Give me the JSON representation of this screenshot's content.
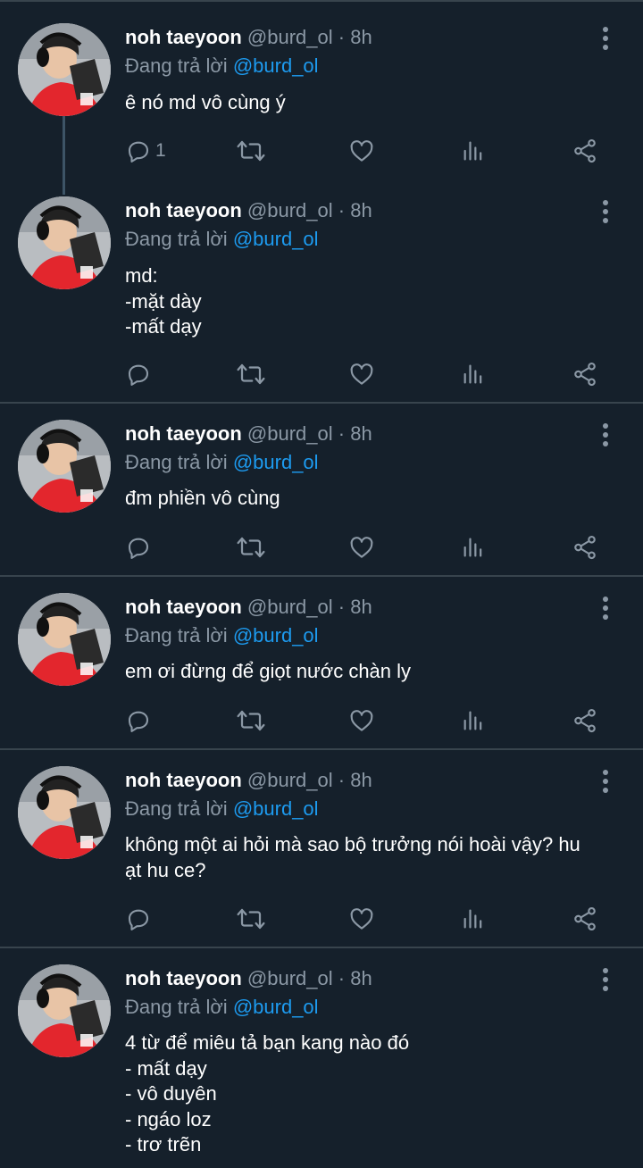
{
  "tweets": [
    {
      "name": "noh taeyoon",
      "handle": "@burd_ol",
      "dot": "·",
      "time": "8h",
      "reply_prefix": "Đang trả lời",
      "reply_to": "@burd_ol",
      "lines": [
        "ê nó md vô cùng ý"
      ],
      "reply_count": "1"
    },
    {
      "name": "noh taeyoon",
      "handle": "@burd_ol",
      "dot": "·",
      "time": "8h",
      "reply_prefix": "Đang trả lời",
      "reply_to": "@burd_ol",
      "lines": [
        "md:",
        "-mặt dày",
        "-mất dạy"
      ],
      "reply_count": ""
    },
    {
      "name": "noh taeyoon",
      "handle": "@burd_ol",
      "dot": "·",
      "time": "8h",
      "reply_prefix": "Đang trả lời",
      "reply_to": "@burd_ol",
      "lines": [
        "đm phiền vô cùng"
      ],
      "reply_count": ""
    },
    {
      "name": "noh taeyoon",
      "handle": "@burd_ol",
      "dot": "·",
      "time": "8h",
      "reply_prefix": "Đang trả lời",
      "reply_to": "@burd_ol",
      "lines": [
        "em ơi đừng để giọt nước chàn ly"
      ],
      "reply_count": ""
    },
    {
      "name": "noh taeyoon",
      "handle": "@burd_ol",
      "dot": "·",
      "time": "8h",
      "reply_prefix": "Đang trả lời",
      "reply_to": "@burd_ol",
      "lines": [
        "không một ai hỏi mà sao bộ trưởng nói hoài vậy? hu",
        "ạt hu ce?"
      ],
      "reply_count": ""
    },
    {
      "name": "noh taeyoon",
      "handle": "@burd_ol",
      "dot": "·",
      "time": "8h",
      "reply_prefix": "Đang trả lời",
      "reply_to": "@burd_ol",
      "lines": [
        "4 từ để miêu tả bạn kang nào đó",
        "- mất dạy",
        "- vô duyên",
        "- ngáo loz",
        "- trơ trẽn"
      ],
      "reply_count": ""
    }
  ],
  "icons": {
    "reply": "reply-icon",
    "retweet": "retweet-icon",
    "like": "like-icon",
    "views": "views-icon",
    "share": "share-icon",
    "more": "more-icon"
  },
  "colors": {
    "background": "#15202b",
    "mention": "#1d9bf0",
    "muted": "#8b98a5",
    "divider": "#38444d"
  }
}
